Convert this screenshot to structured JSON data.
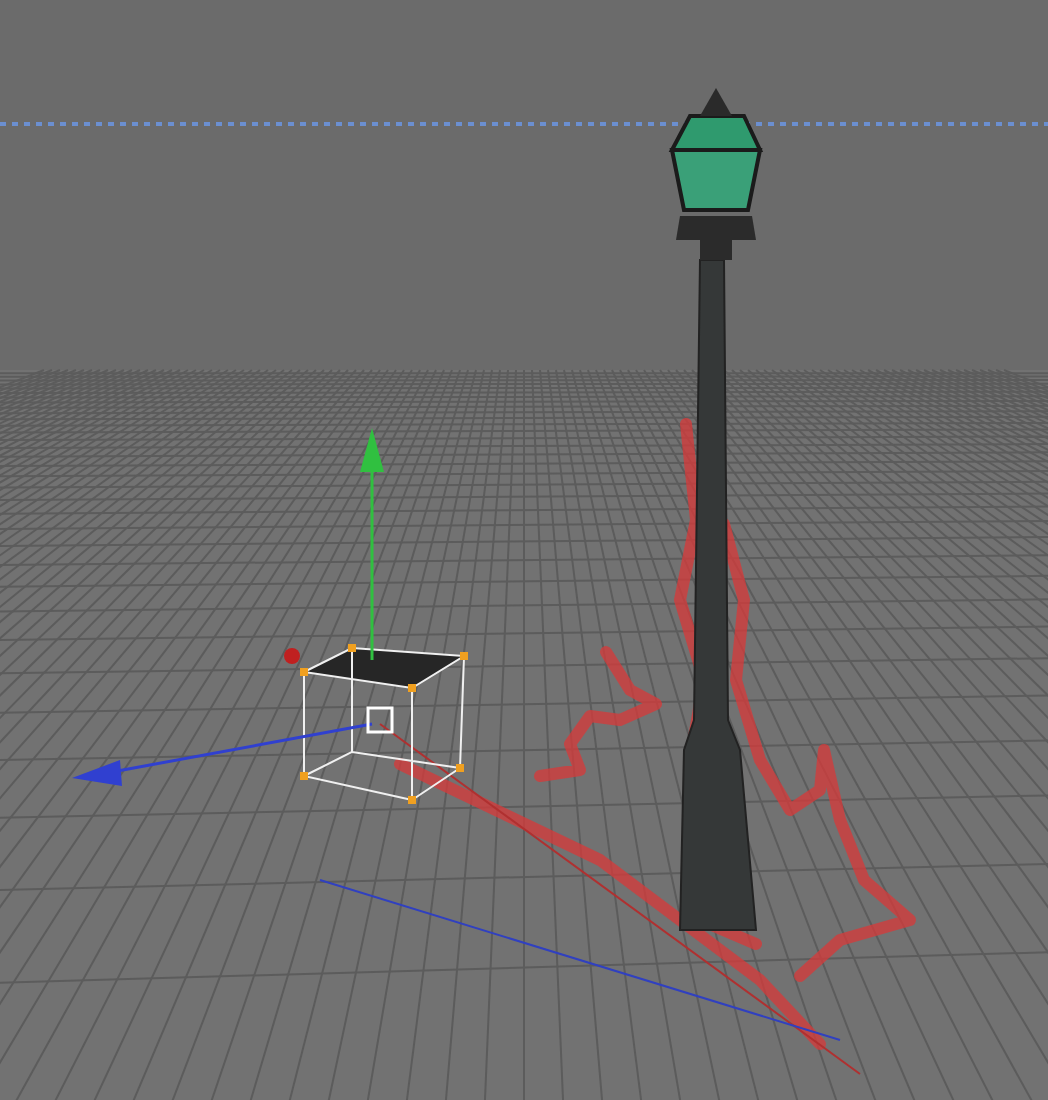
{
  "viewport": {
    "grid": true,
    "horizon_guide": true
  }
}
